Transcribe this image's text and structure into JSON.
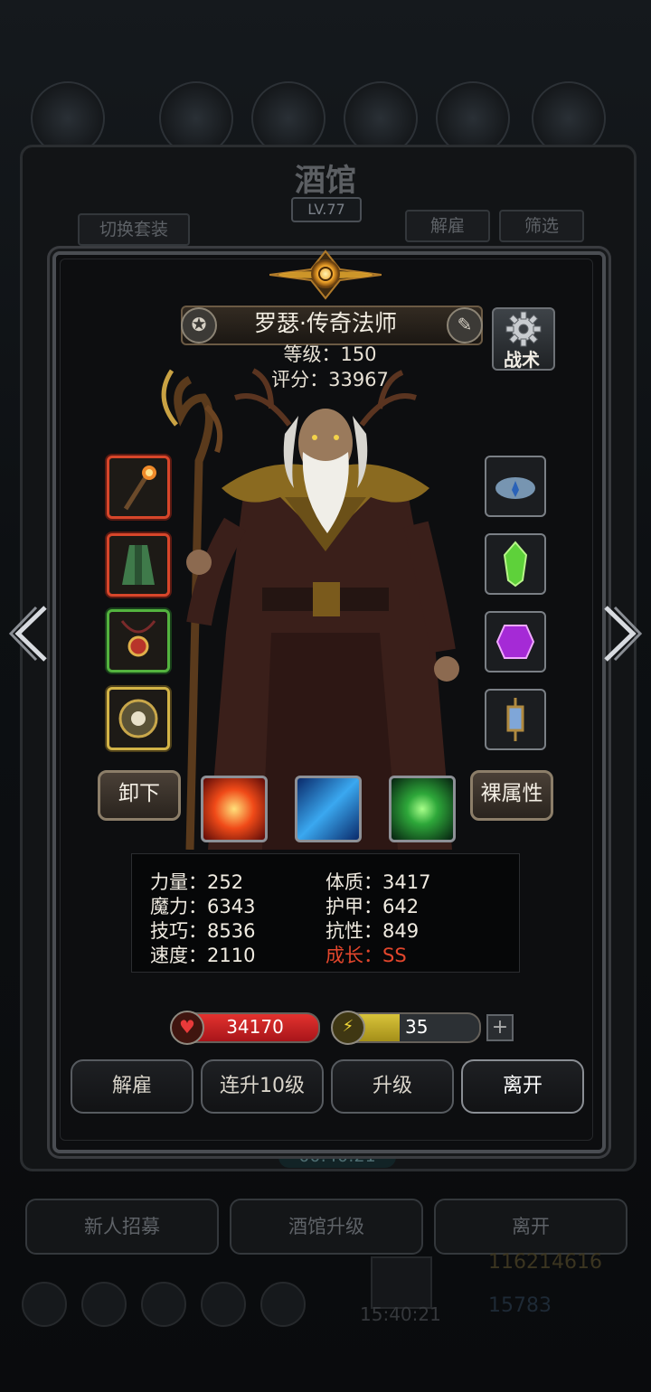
{
  "background": {
    "title": "酒馆",
    "level": "LV.77",
    "switch_outfit": "切换套装",
    "dismiss": "解雇",
    "filter": "筛选",
    "timer": "00:40:21",
    "recruit": "新人招募",
    "upgrade_tavern": "酒馆升级",
    "leave": "离开",
    "gold": "116214616",
    "clock": "15:40:21",
    "gems": "15783"
  },
  "hero": {
    "name": "罗瑟·传奇法师",
    "level_line": "等级：150",
    "score_line": "评分：33967",
    "tactics_label": "战术"
  },
  "buttons": {
    "unequip": "卸下",
    "naked_stats": "裸属性"
  },
  "stats": {
    "strength": "力量：252",
    "magic": "魔力：6343",
    "skill": "技巧：8536",
    "speed": "速度：2110",
    "constitution": "体质：3417",
    "armor": "护甲：642",
    "resistance": "抗性：849",
    "growth": "成长：SS"
  },
  "bars": {
    "hp": "34170",
    "energy": "35",
    "energy_fill": 0.45,
    "plus": "+"
  },
  "actions": {
    "dismiss": "解雇",
    "level_up_10": "连升10级",
    "level_up": "升级",
    "leave": "离开"
  },
  "icons": {
    "left_slots": [
      "staff-icon",
      "robe-icon",
      "amulet-icon",
      "medallion-icon"
    ],
    "right_slots": [
      "crown-icon",
      "green-gem-icon",
      "purple-gem-icon",
      "lantern-icon"
    ],
    "skills": [
      "fire-burst-icon",
      "ice-slash-icon",
      "nature-light-icon"
    ]
  },
  "colors": {
    "hp": "#d42328",
    "energy": "#cdb52c",
    "growth": "#e2462c"
  }
}
